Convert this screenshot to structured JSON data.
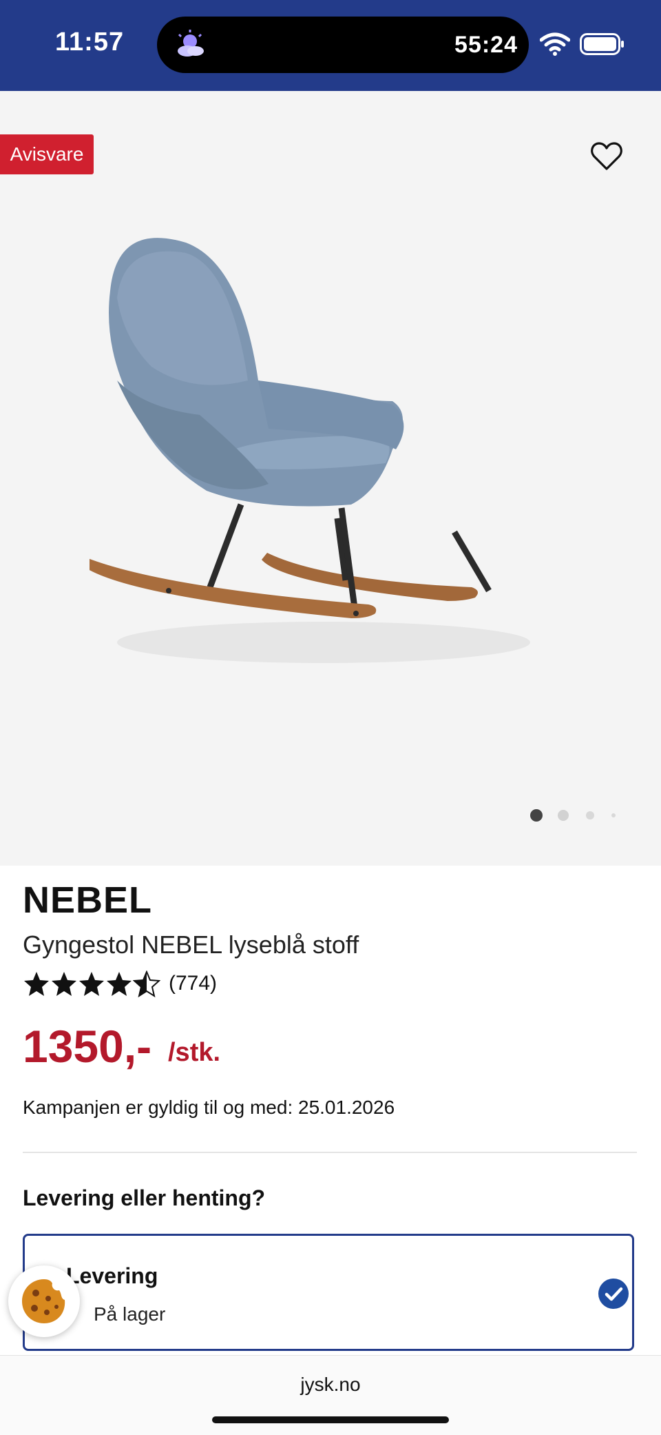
{
  "status_bar": {
    "time": "11:57",
    "timer": "55:24",
    "icons": [
      "weather-icon",
      "wifi-icon",
      "battery-icon"
    ]
  },
  "product": {
    "badge": "Avisvare",
    "brand": "NEBEL",
    "name": "Gyngestol NEBEL lyseblå stoff",
    "rating": 4.5,
    "rating_count": "(774)",
    "price": "1350,-",
    "unit": "/stk.",
    "campaign_text": "Kampanjen er gyldig til og med: 25.01.2026",
    "image_count": 4,
    "active_image": 1
  },
  "delivery": {
    "heading": "Levering eller henting?",
    "option_title": "Levering",
    "option_stock": "På lager"
  },
  "browser": {
    "url": "jysk.no"
  },
  "colors": {
    "brand_blue": "#233b8a",
    "price_red": "#b3192b",
    "badge_red": "#d0202f"
  }
}
